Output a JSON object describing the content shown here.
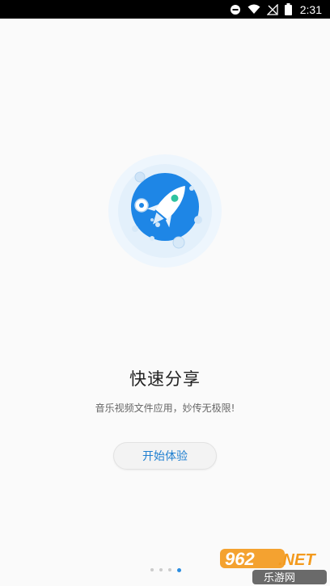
{
  "status_bar": {
    "time": "2:31",
    "icons": [
      "do-not-disturb-icon",
      "wifi-icon",
      "no-signal-icon",
      "battery-icon"
    ]
  },
  "onboarding": {
    "title": "快速分享",
    "subtitle": "音乐视频文件应用，妙传无极限!",
    "start_button_label": "开始体验",
    "page_count": 4,
    "active_page": 4
  },
  "watermark": {
    "brand": "962.NET",
    "subtext": "乐游网"
  },
  "colors": {
    "accent": "#1f7fd0",
    "rocket_circle": "#1e86e6",
    "dot_active": "#2b8de0",
    "dot_inactive": "#cccccc",
    "watermark_orange": "#f39a1e"
  }
}
